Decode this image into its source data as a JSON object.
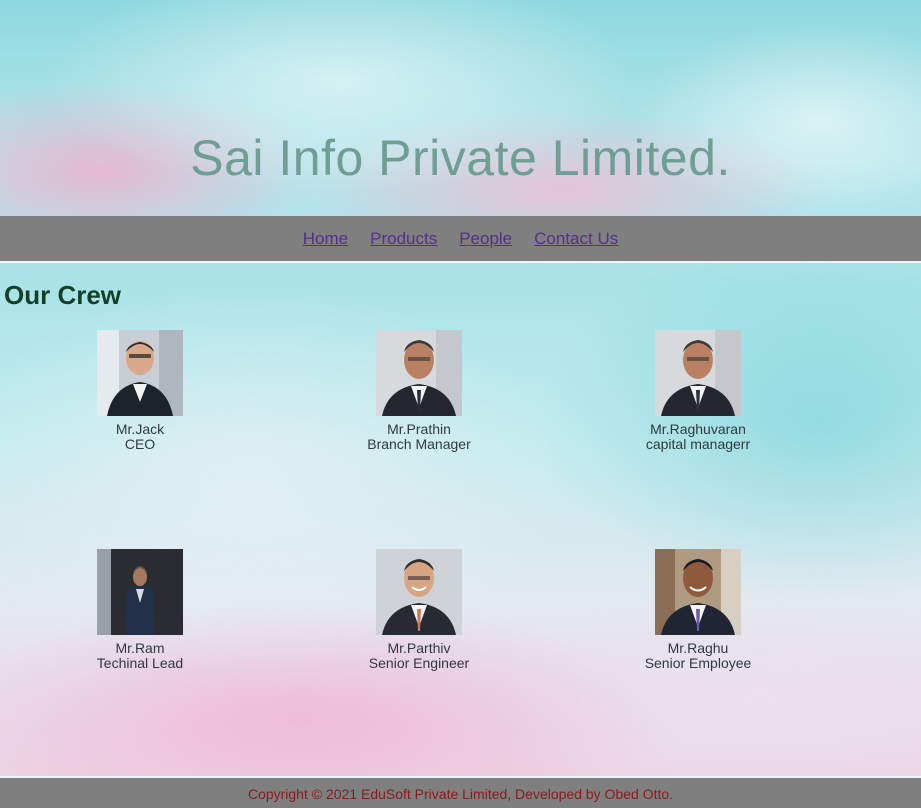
{
  "header": {
    "title": "Sai Info Private Limited."
  },
  "nav": {
    "items": [
      {
        "label": "Home"
      },
      {
        "label": "Products"
      },
      {
        "label": "People"
      },
      {
        "label": "Contact Us"
      }
    ]
  },
  "crew": {
    "title": "Our Crew",
    "members": [
      {
        "name": "Mr.Jack",
        "role": "CEO"
      },
      {
        "name": "Mr.Prathin",
        "role": "Branch Manager"
      },
      {
        "name": "Mr.Raghuvaran",
        "role": "capital managerr"
      },
      {
        "name": "Mr.Ram",
        "role": "Techinal Lead"
      },
      {
        "name": "Mr.Parthiv",
        "role": "Senior Engineer"
      },
      {
        "name": "Mr.Raghu",
        "role": "Senior Employee"
      }
    ]
  },
  "footer": {
    "text": "Copyright © 2021 EduSoft Private Limited, Developed by Obed Otto."
  },
  "colors": {
    "title": "#6f9e93",
    "nav_bg": "#7f7f7f",
    "link": "#54308c",
    "heading": "#163f27",
    "footer_text": "#8b1a1a"
  }
}
